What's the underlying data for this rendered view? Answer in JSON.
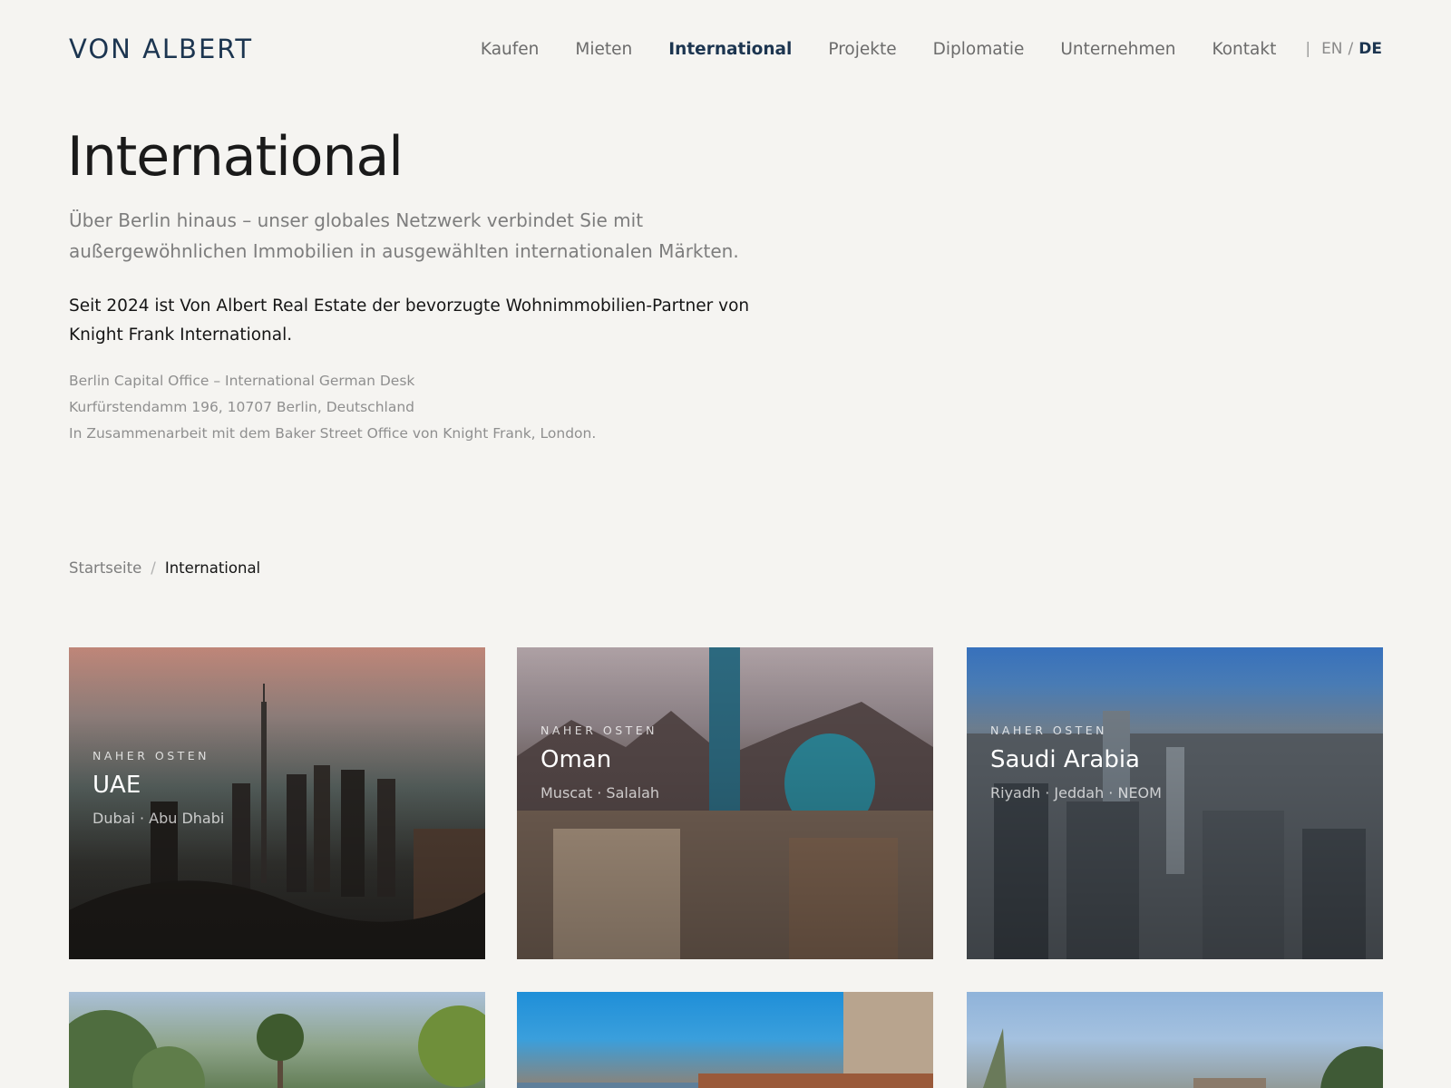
{
  "header": {
    "logo": "VON ALBERT",
    "nav": [
      {
        "label": "Kaufen"
      },
      {
        "label": "Mieten"
      },
      {
        "label": "International"
      },
      {
        "label": "Projekte"
      },
      {
        "label": "Diplomatie"
      },
      {
        "label": "Unternehmen"
      },
      {
        "label": "Kontakt"
      }
    ],
    "active_nav": "International",
    "lang": {
      "separator": "|",
      "en": "EN",
      "slash": "/",
      "de": "DE",
      "active": "DE"
    }
  },
  "intro": {
    "title": "International",
    "lead": "Über Berlin hinaus – unser globales Netzwerk verbindet Sie mit außergewöhnlichen Immobilien in ausgewählten internationalen Märkten.",
    "partner": "Seit 2024 ist Von Albert Real Estate der bevorzugte Wohnimmobilien-Partner von Knight Frank International.",
    "address": {
      "line1": "Berlin Capital Office – International German Desk",
      "line2": "Kurfürstendamm 196, 10707 Berlin, Deutschland",
      "line3": "In Zusammenarbeit mit dem Baker Street Office von Knight Frank, London."
    }
  },
  "breadcrumb": {
    "home": "Startseite",
    "separator": "/",
    "current": "International"
  },
  "cards": [
    {
      "region": "NAHER OSTEN",
      "name": "UAE",
      "cities": "Dubai · Abu Dhabi"
    },
    {
      "region": "NAHER OSTEN",
      "name": "Oman",
      "cities": "Muscat · Salalah"
    },
    {
      "region": "NAHER OSTEN",
      "name": "Saudi Arabia",
      "cities": "Riyadh · Jeddah · NEOM"
    }
  ],
  "colors": {
    "background": "#f5f4f1",
    "brand": "#1c3550",
    "text": "#1a1a1a",
    "muted": "#7d7d7d"
  }
}
